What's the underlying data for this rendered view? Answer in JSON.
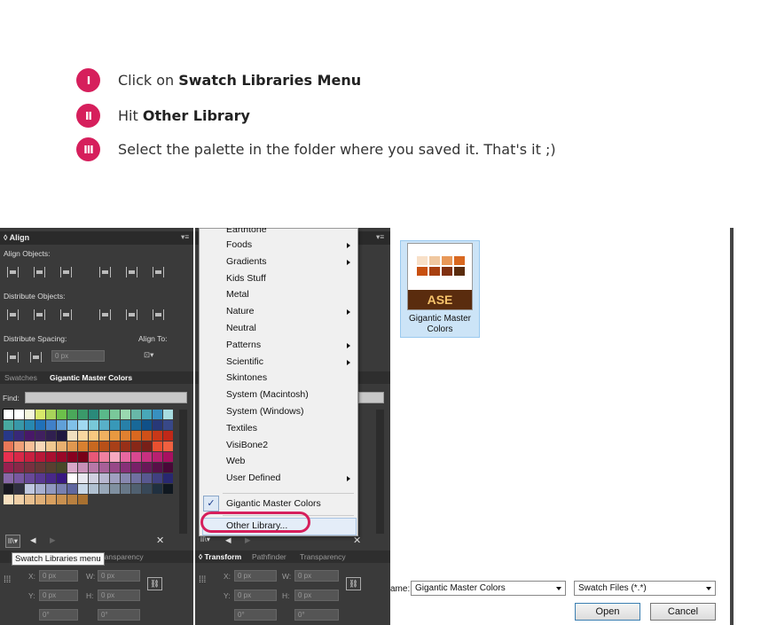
{
  "steps": [
    {
      "badge": "I",
      "pre": "Click on ",
      "bold": "Swatch Libraries Menu",
      "post": ""
    },
    {
      "badge": "II",
      "pre": "Hit ",
      "bold": "Other Library",
      "post": ""
    },
    {
      "badge": "III",
      "pre": "Select the palette in the folder where you saved it. That's it ;)",
      "bold": "",
      "post": ""
    }
  ],
  "align_panel": {
    "title": "◊ Align",
    "align_objects": "Align Objects:",
    "distribute_objects": "Distribute Objects:",
    "distribute_spacing": "Distribute Spacing:",
    "align_to": "Align To:",
    "spacing_value": "0 px"
  },
  "swatch_panel": {
    "tab_swatches": "Swatches",
    "tab_library": "Gigantic Master Colors",
    "find_label": "Find:",
    "tooltip": "Swatch Libraries menu"
  },
  "bottom_tabs": {
    "left": [
      "Transparency"
    ],
    "right": [
      "◊ Transform",
      "Pathfinder",
      "Transparency"
    ]
  },
  "transform": {
    "x_label": "X:",
    "y_label": "Y:",
    "w_label": "W:",
    "h_label": "H:",
    "x": "0 px",
    "y": "0 px",
    "w": "0 px",
    "h": "0 px",
    "angle": "0°",
    "shear": "0°"
  },
  "menu": {
    "top_partial": "Earthtone",
    "items": [
      {
        "label": "Foods",
        "submenu": true
      },
      {
        "label": "Gradients",
        "submenu": true
      },
      {
        "label": "Kids Stuff",
        "submenu": false
      },
      {
        "label": "Metal",
        "submenu": false
      },
      {
        "label": "Nature",
        "submenu": true
      },
      {
        "label": "Neutral",
        "submenu": false
      },
      {
        "label": "Patterns",
        "submenu": true
      },
      {
        "label": "Scientific",
        "submenu": true
      },
      {
        "label": "Skintones",
        "submenu": false
      },
      {
        "label": "System (Macintosh)",
        "submenu": false
      },
      {
        "label": "System (Windows)",
        "submenu": false
      },
      {
        "label": "Textiles",
        "submenu": false
      },
      {
        "label": "VisiBone2",
        "submenu": false
      },
      {
        "label": "Web",
        "submenu": false
      },
      {
        "label": "User Defined",
        "submenu": true
      }
    ],
    "checked_item": "Gigantic Master Colors",
    "other_library": "Other Library..."
  },
  "dialog": {
    "file_name_label": "ame:",
    "file_icon_text": "ASE",
    "file_label": "Gigantic Master Colors",
    "file_name_value": "Gigantic Master Colors",
    "file_type": "Swatch Files (*.*)",
    "open": "Open",
    "cancel": "Cancel"
  },
  "colors": {
    "accent": "#d61f5c",
    "panel_bg": "#3a3a3a",
    "selection": "#cce4f7"
  },
  "swatch_rows": [
    [
      "#ffffff",
      "#ffffff",
      "#f5f5dc",
      "#d8e86a",
      "#a8d45a",
      "#6cc04a",
      "#4aa85a",
      "#3a9a6a",
      "#2a8a7a",
      "#5ab88a",
      "#7ac89a",
      "#9ad8b0",
      "#68b8a8",
      "#48a8b8",
      "#3890c0",
      "#a8dce0"
    ],
    [
      "#48a8a0",
      "#3898a8",
      "#2888b0",
      "#2070b8",
      "#4080c8",
      "#60a0d8",
      "#80c0e8",
      "#a0d8f0",
      "#78c8d8",
      "#58b0c8",
      "#3898b8",
      "#2880a8",
      "#186898",
      "#105088",
      "#283878",
      "#384888"
    ],
    [
      "#283888",
      "#382878",
      "#481868",
      "#402060",
      "#302050",
      "#201840",
      "#f0e0c0",
      "#f8d8a0",
      "#f8c880",
      "#f0b060",
      "#e89840",
      "#e08030",
      "#d86820",
      "#d05018",
      "#c83818",
      "#c02818"
    ],
    [
      "#e87858",
      "#f0a078",
      "#f8c098",
      "#f8d8b8",
      "#f0c890",
      "#e8b070",
      "#e09850",
      "#d88030",
      "#c86820",
      "#b85018",
      "#a84018",
      "#983018",
      "#882818",
      "#782018",
      "#e85030",
      "#f06040"
    ],
    [
      "#e83050",
      "#d82848",
      "#c82040",
      "#b81838",
      "#a81030",
      "#980828",
      "#880020",
      "#780018",
      "#e85878",
      "#f080a0",
      "#f8a8c0",
      "#e868a0",
      "#d84890",
      "#c83080",
      "#b82070",
      "#a81060"
    ],
    [
      "#982050",
      "#882848",
      "#783040",
      "#683838",
      "#584030",
      "#484828",
      "#d8a8c8",
      "#c890b8",
      "#b878a8",
      "#a86098",
      "#984888",
      "#883078",
      "#782068",
      "#681858",
      "#581048",
      "#480838"
    ],
    [
      "#8868a8",
      "#7858a0",
      "#684898",
      "#583890",
      "#482888",
      "#381880",
      "#ffffff",
      "#e8e8f0",
      "#d0d0e0",
      "#b8b8d0",
      "#a0a0c0",
      "#8888b0",
      "#7070a0",
      "#585890",
      "#404080",
      "#282870"
    ],
    [
      "#181820",
      "#303040",
      "#c0c8e0",
      "#a8b0d0",
      "#9098c0",
      "#7880b0",
      "#6068a0",
      "#c8d8e8",
      "#b0c0d0",
      "#98a8b8",
      "#8090a0",
      "#687888",
      "#506070",
      "#384858",
      "#203040",
      "#101820"
    ],
    [
      "#f8e0c0",
      "#f0d0a8",
      "#e8c090",
      "#e0b078",
      "#d8a060",
      "#c89050",
      "#b88040",
      "#a87030"
    ]
  ],
  "ase_swatches": [
    "#f8e0c8",
    "#f0c8a0",
    "#e89858",
    "#d86820",
    "#c85010",
    "#a84010",
    "#803010",
    "#5a2c0e"
  ]
}
